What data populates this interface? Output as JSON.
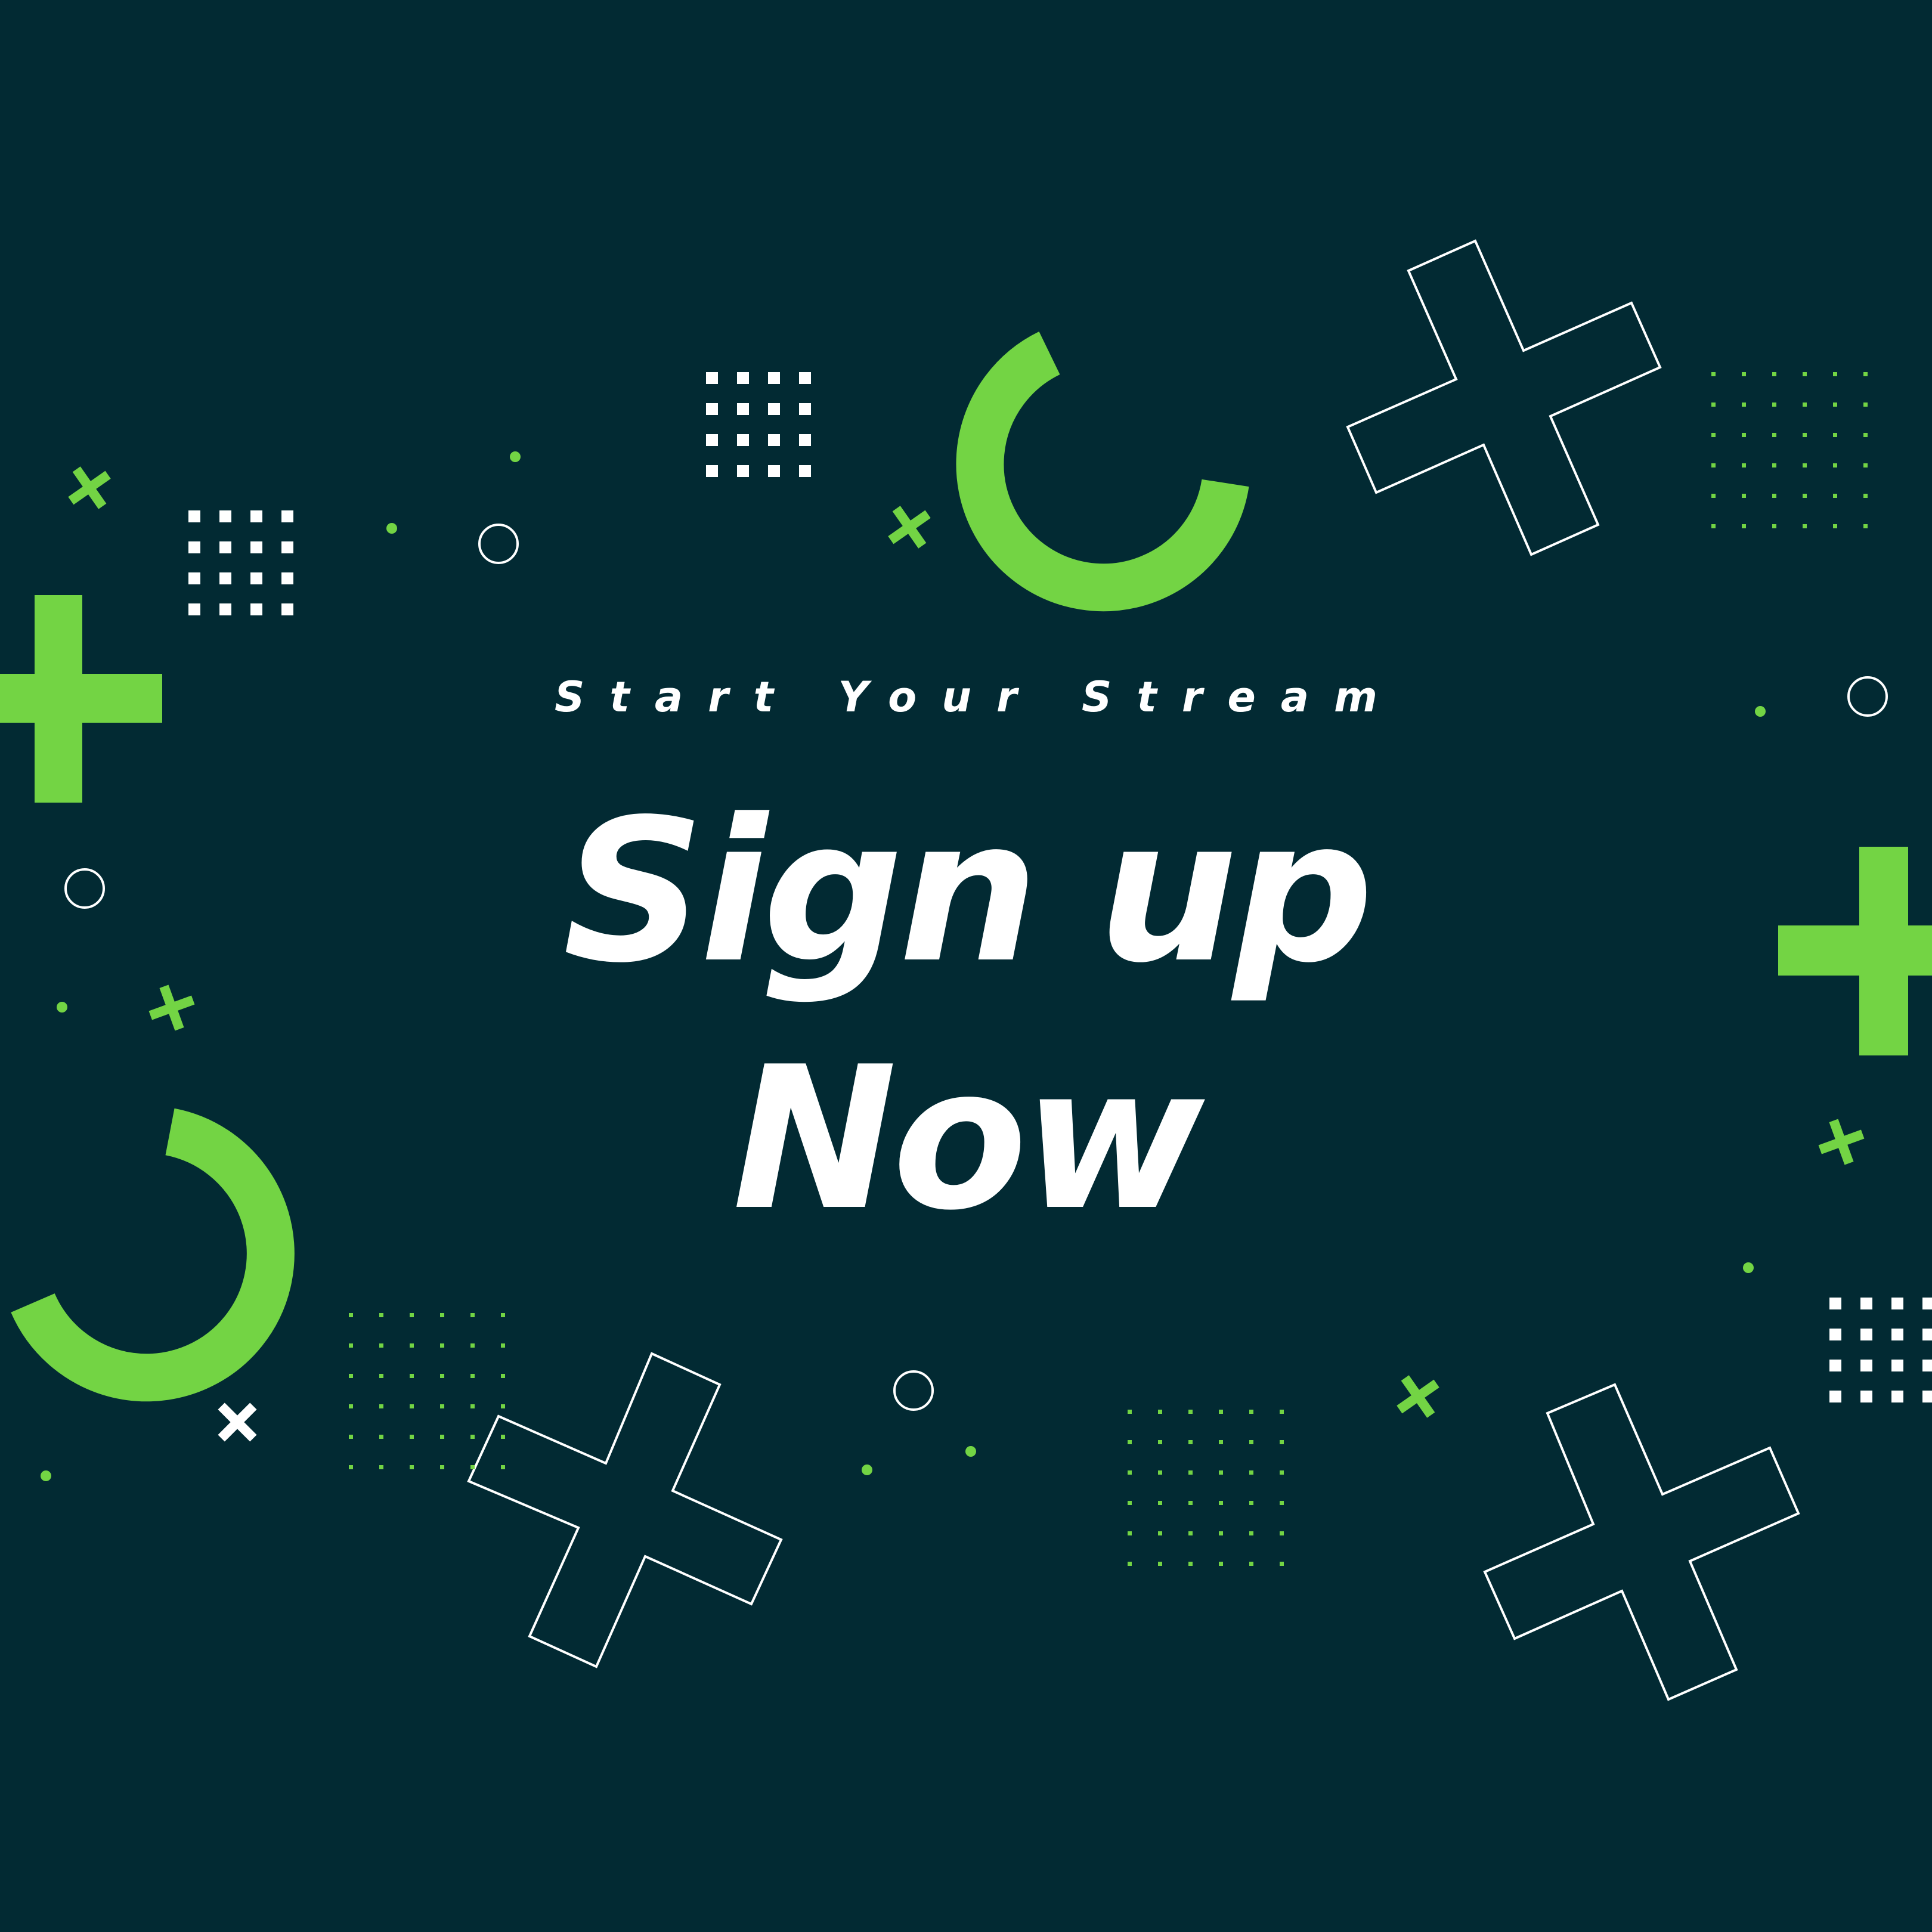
{
  "colors": {
    "background": "#022a33",
    "accent": "#73d444",
    "foreground": "#ffffff"
  },
  "tagline": "Start Your Stream",
  "headline": {
    "line1": "Sign up",
    "line2": "Now"
  }
}
